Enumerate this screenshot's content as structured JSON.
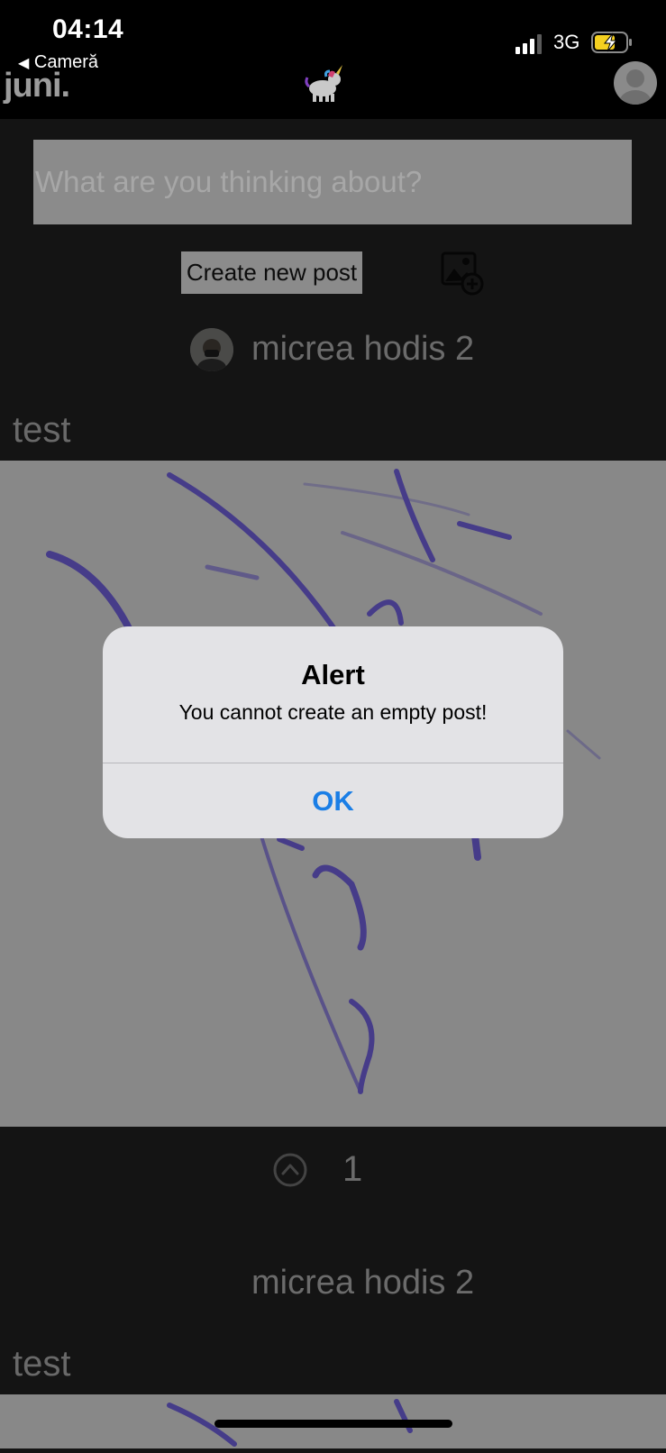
{
  "status_bar": {
    "time": "04:14",
    "back_label": "Cameră",
    "network": "3G"
  },
  "header": {
    "logo": "juni."
  },
  "compose": {
    "placeholder": "What are you thinking about?",
    "create_label": "Create new post"
  },
  "posts": [
    {
      "author": "micrea hodis 2",
      "text": "test",
      "votes": "1"
    },
    {
      "author": "micrea hodis 2",
      "text": "test"
    }
  ],
  "alert": {
    "title": "Alert",
    "message": "You cannot create an empty post!",
    "ok_label": "OK"
  },
  "colors": {
    "ok_blue": "#1a7ee6",
    "battery_yellow": "#f5d020",
    "handwriting": "#3a2f8a"
  }
}
